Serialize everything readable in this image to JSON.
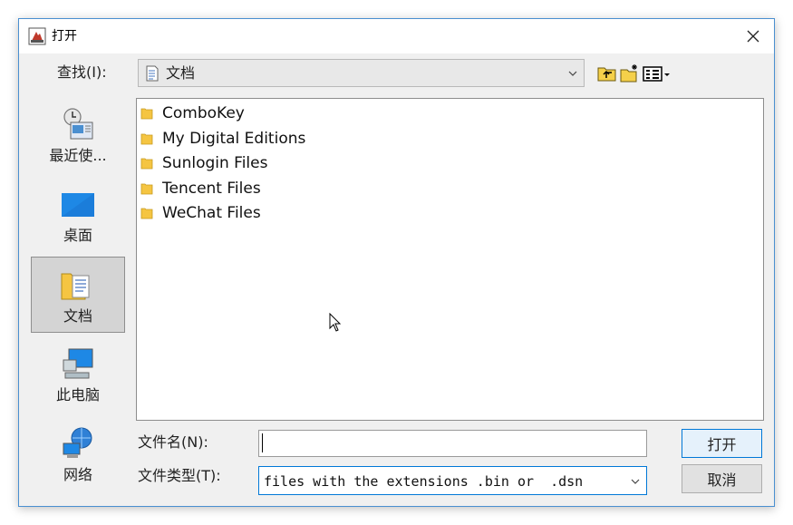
{
  "window": {
    "title": "打开",
    "close_icon": "close-icon",
    "app_icon": "java-app-icon"
  },
  "lookin": {
    "label": "查找(I):",
    "value": "文档",
    "icon": "document-icon"
  },
  "toolbar": {
    "up_icon": "up-folder-icon",
    "new_folder_icon": "new-folder-icon",
    "view_icon": "view-menu-icon"
  },
  "places": [
    {
      "label": "最近使...",
      "icon": "recent-icon"
    },
    {
      "label": "桌面",
      "icon": "desktop-icon"
    },
    {
      "label": "文档",
      "icon": "documents-icon",
      "selected": true
    },
    {
      "label": "此电脑",
      "icon": "computer-icon"
    },
    {
      "label": "网络",
      "icon": "network-icon"
    }
  ],
  "files": [
    {
      "name": "ComboKey"
    },
    {
      "name": "My Digital Editions"
    },
    {
      "name": "Sunlogin Files"
    },
    {
      "name": "Tencent Files"
    },
    {
      "name": "WeChat Files"
    }
  ],
  "filename": {
    "label": "文件名(N):",
    "value": ""
  },
  "filetype": {
    "label": "文件类型(T):",
    "value": "files with the extensions .bin or  .dsn"
  },
  "buttons": {
    "open": "打开",
    "cancel": "取消"
  },
  "colors": {
    "accent": "#0078d7",
    "folder": "#f5c542"
  }
}
